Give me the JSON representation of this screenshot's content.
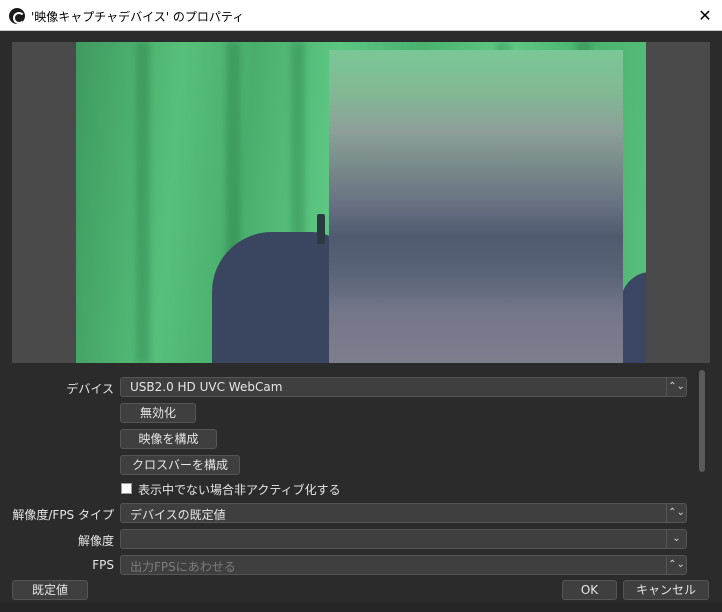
{
  "window": {
    "title": "'映像キャプチャデバイス' のプロパティ",
    "close_glyph": "✕"
  },
  "properties": {
    "device": {
      "label": "デバイス",
      "value": "USB2.0 HD UVC WebCam"
    },
    "deactivate_button": "無効化",
    "configure_video_button": "映像を構成",
    "configure_crossbar_button": "クロスバーを構成",
    "deactivate_when_hidden": {
      "label": "表示中でない場合非アクティブ化する",
      "checked": false
    },
    "resolution_fps_type": {
      "label": "解像度/FPS タイプ",
      "value": "デバイスの既定値"
    },
    "resolution": {
      "label": "解像度",
      "value": ""
    },
    "fps": {
      "label": "FPS",
      "value": "出力FPSにあわせる"
    }
  },
  "footer": {
    "defaults_button": "既定値",
    "ok_button": "OK",
    "cancel_button": "キャンセル"
  },
  "icons": {
    "combo_updown": "⌃⌄",
    "combo_down": "⌄"
  }
}
